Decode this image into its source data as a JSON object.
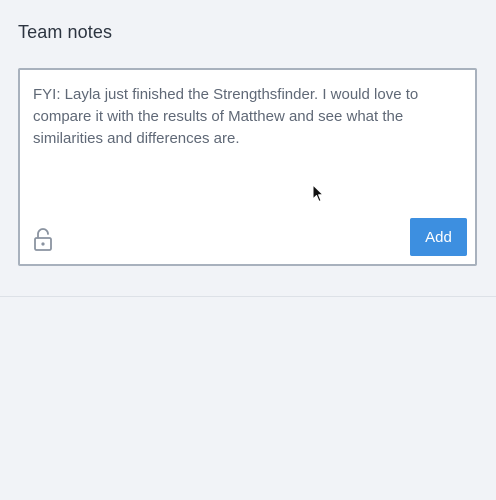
{
  "section": {
    "title": "Team notes"
  },
  "note": {
    "text": "FYI: Layla just finished the Strengthsfinder. I would love to compare it with the results of Matthew and see what the similarities and differences are.",
    "privacy_icon": "unlocked-padlock-icon",
    "add_label": "Add"
  },
  "pointer": {
    "icon": "mouse-pointer-icon"
  },
  "colors": {
    "background": "#f1f3f7",
    "accent": "#3d8fe0",
    "border": "#a8b1bd",
    "text": "#5f6876",
    "heading": "#2c3440"
  }
}
